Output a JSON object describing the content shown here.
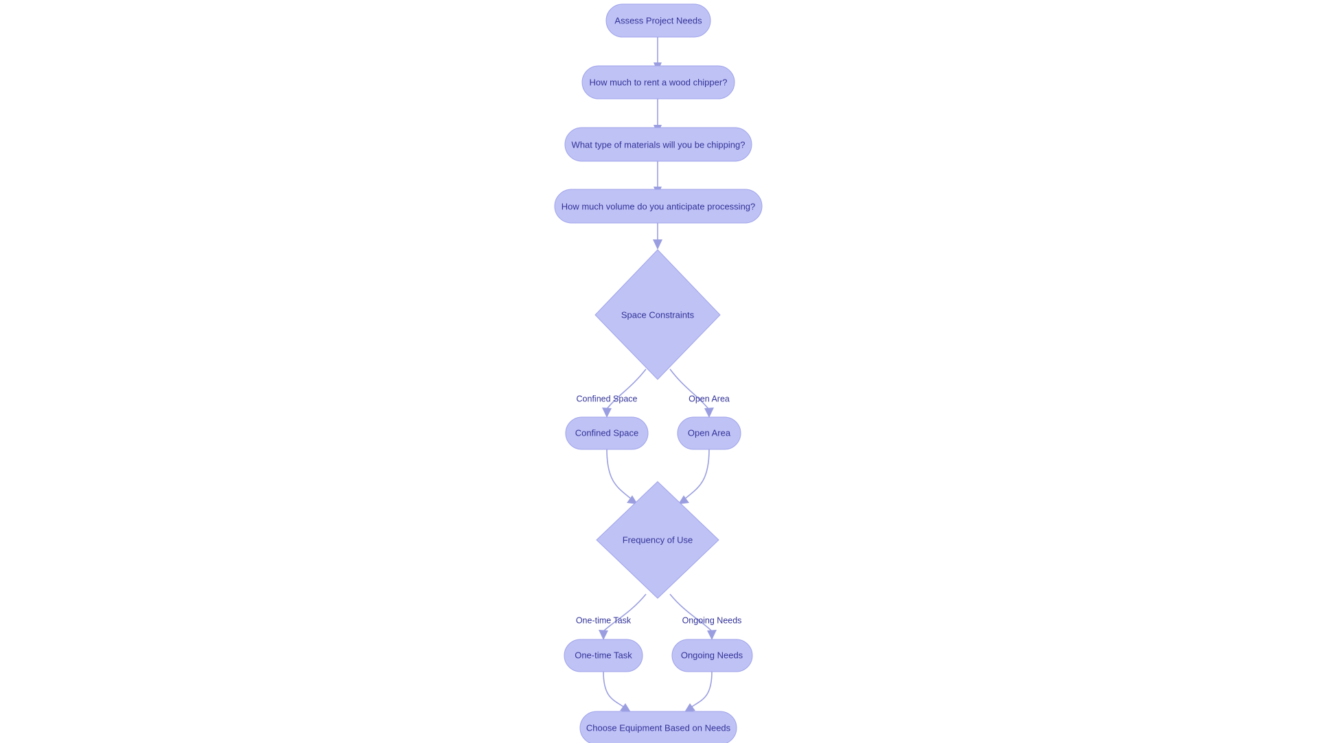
{
  "diagram": {
    "type": "flowchart",
    "direction": "top-to-bottom",
    "background_color": "#ffffff",
    "node_fill_color": "#bfc2f5",
    "node_border_color": "#9fa3ea",
    "node_text_color": "#333399",
    "edge_color": "#9a9ee0",
    "nodes": [
      {
        "id": "n1",
        "label": "Assess Project Needs",
        "shape": "stadium"
      },
      {
        "id": "n2",
        "label": "How much to rent a wood chipper?",
        "shape": "stadium"
      },
      {
        "id": "n3",
        "label": "What type of materials will you be chipping?",
        "shape": "stadium"
      },
      {
        "id": "n4",
        "label": "How much volume do you anticipate processing?",
        "shape": "stadium"
      },
      {
        "id": "d1",
        "label": "Space Constraints",
        "shape": "diamond"
      },
      {
        "id": "n5",
        "label": "Confined Space",
        "shape": "stadium"
      },
      {
        "id": "n6",
        "label": "Open Area",
        "shape": "stadium"
      },
      {
        "id": "d2",
        "label": "Frequency of Use",
        "shape": "diamond"
      },
      {
        "id": "n7",
        "label": "One-time Task",
        "shape": "stadium"
      },
      {
        "id": "n8",
        "label": "Ongoing Needs",
        "shape": "stadium"
      },
      {
        "id": "n9",
        "label": "Choose Equipment Based on Needs",
        "shape": "stadium"
      }
    ],
    "edges": [
      {
        "from": "n1",
        "to": "n2",
        "label": ""
      },
      {
        "from": "n2",
        "to": "n3",
        "label": ""
      },
      {
        "from": "n3",
        "to": "n4",
        "label": ""
      },
      {
        "from": "n4",
        "to": "d1",
        "label": ""
      },
      {
        "from": "d1",
        "to": "n5",
        "label": "Confined Space"
      },
      {
        "from": "d1",
        "to": "n6",
        "label": "Open Area"
      },
      {
        "from": "n5",
        "to": "d2",
        "label": ""
      },
      {
        "from": "n6",
        "to": "d2",
        "label": ""
      },
      {
        "from": "d2",
        "to": "n7",
        "label": "One-time Task"
      },
      {
        "from": "d2",
        "to": "n8",
        "label": "Ongoing Needs"
      },
      {
        "from": "n7",
        "to": "n9",
        "label": ""
      },
      {
        "from": "n8",
        "to": "n9",
        "label": ""
      }
    ]
  }
}
